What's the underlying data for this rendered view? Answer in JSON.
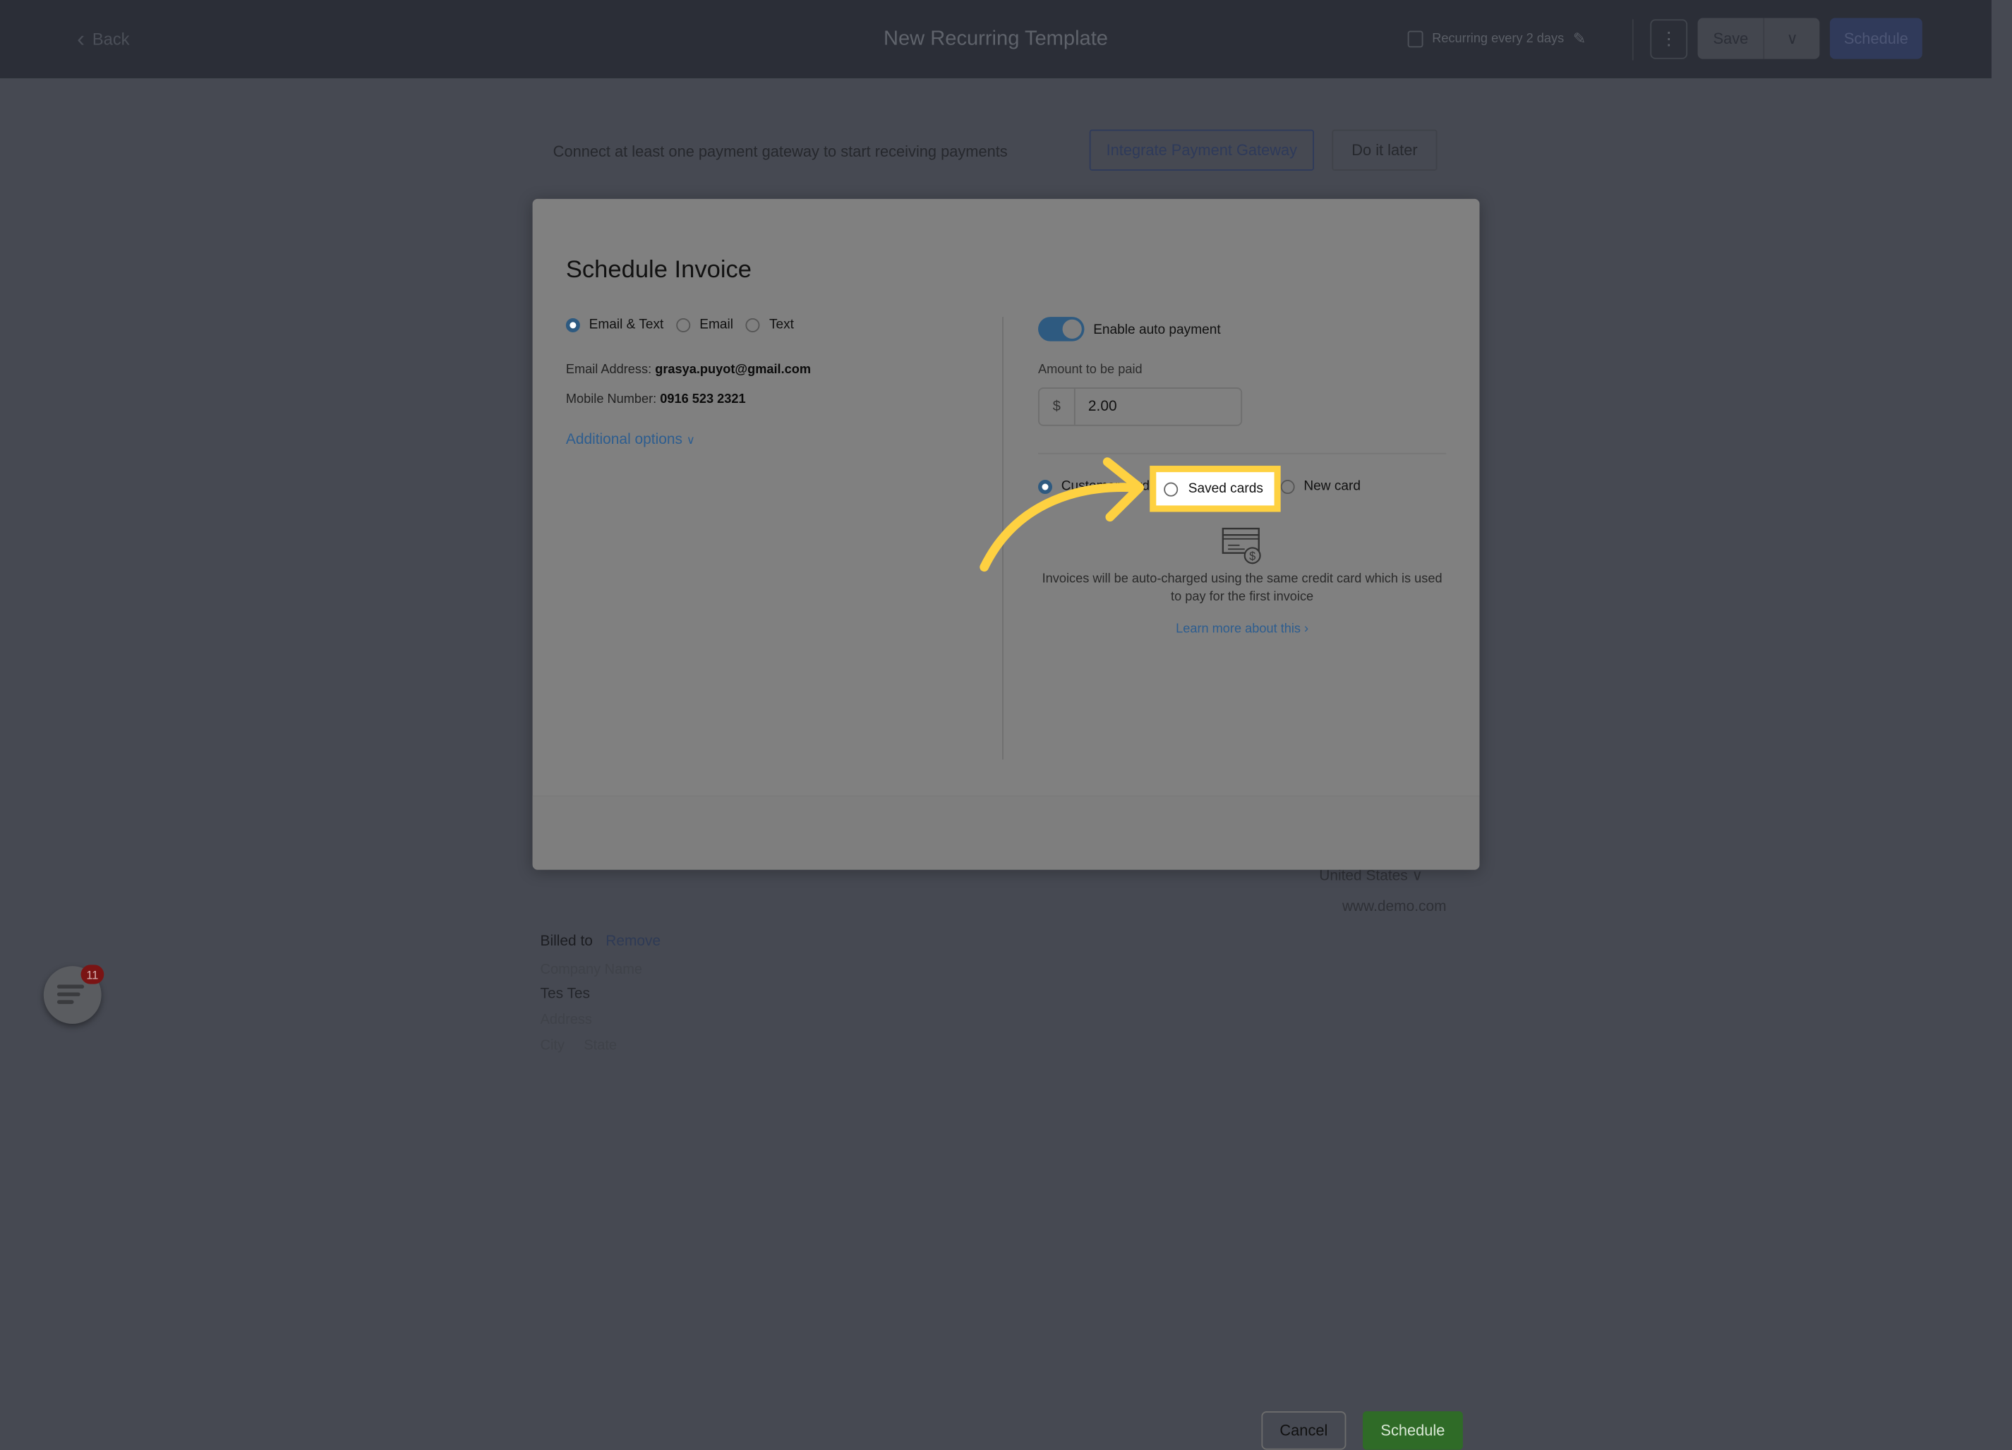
{
  "header": {
    "back_label": "Back",
    "title": "New Recurring Template",
    "recurrence_label": "Recurring every 2 days",
    "save_label": "Save",
    "schedule_label": "Schedule"
  },
  "banner": {
    "text": "Connect at least one payment gateway to start receiving payments",
    "integrate_label": "Integrate Payment Gateway",
    "later_label": "Do it later"
  },
  "modal": {
    "title": "Schedule Invoice",
    "delivery_options": [
      {
        "label": "Email & Text",
        "selected": true
      },
      {
        "label": "Email",
        "selected": false
      },
      {
        "label": "Text",
        "selected": false
      }
    ],
    "email_label": "Email Address:",
    "email_value": "grasya.puyot@gmail.com",
    "mobile_label": "Mobile Number:",
    "mobile_value": "0916 523 2321",
    "additional_options": "Additional options",
    "auto_payment_label": "Enable auto payment",
    "auto_payment_enabled": true,
    "amount_label": "Amount to be paid",
    "currency_symbol": "$",
    "amount_value": "2.00",
    "card_options": [
      {
        "label": "Customer card",
        "selected": true
      },
      {
        "label": "Saved cards",
        "selected": false
      },
      {
        "label": "New card",
        "selected": false
      }
    ],
    "info_text": "Invoices will be auto-charged using the same credit card which is used to pay for the first invoice",
    "learn_more": "Learn more about this",
    "cancel_label": "Cancel",
    "schedule_label": "Schedule"
  },
  "background": {
    "country": "United States",
    "website": "www.demo.com",
    "billed_to": "Billed to",
    "remove": "Remove",
    "company_placeholder": "Company Name",
    "client_name": "Tes Tes",
    "address_placeholder": "Address",
    "city_placeholder": "City",
    "state_placeholder": "State"
  },
  "chat": {
    "badge_count": "11"
  },
  "colors": {
    "highlight": "#fed141",
    "accent": "#2e5a80",
    "schedule_green": "#2f6b27"
  }
}
